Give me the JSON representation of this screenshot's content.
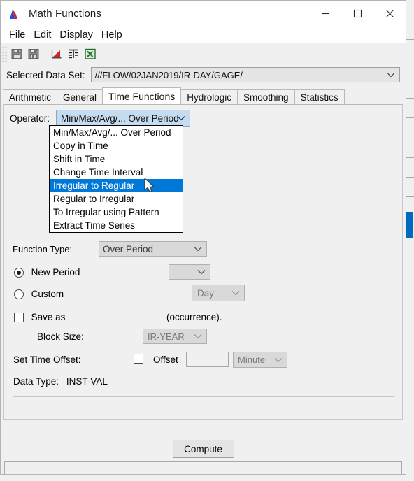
{
  "window": {
    "title": "Math Functions",
    "app_icon": "hec-dssvue-peak-icon",
    "controls": {
      "minimize": "—",
      "maximize": "☐",
      "close": "✕"
    }
  },
  "menu": {
    "items": [
      {
        "label": "File",
        "name": "menu-file"
      },
      {
        "label": "Edit",
        "name": "menu-edit"
      },
      {
        "label": "Display",
        "name": "menu-display"
      },
      {
        "label": "Help",
        "name": "menu-help"
      }
    ]
  },
  "toolbar": {
    "buttons": [
      {
        "icon": "save-icon",
        "name": "toolbar-save"
      },
      {
        "icon": "save-as-icon",
        "name": "toolbar-save-as"
      },
      {
        "icon": "plot-chart-icon",
        "name": "toolbar-plot"
      },
      {
        "icon": "table-icon",
        "name": "toolbar-table"
      },
      {
        "icon": "excel-export-icon",
        "name": "toolbar-excel"
      }
    ]
  },
  "dataset": {
    "label": "Selected Data Set:",
    "value": "///FLOW/02JAN2019/IR-DAY/GAGE/",
    "arrow_icon": "chevron-down-icon"
  },
  "tabs": [
    {
      "label": "Arithmetic",
      "active": false
    },
    {
      "label": "General",
      "active": false
    },
    {
      "label": "Time Functions",
      "active": true
    },
    {
      "label": "Hydrologic",
      "active": false
    },
    {
      "label": "Smoothing",
      "active": false
    },
    {
      "label": "Statistics",
      "active": false
    }
  ],
  "operator": {
    "label": "Operator:",
    "value": "Min/Max/Avg/... Over Period",
    "expanded": true,
    "options": [
      "Min/Max/Avg/... Over Period",
      "Copy in Time",
      "Shift in Time",
      "Change Time Interval",
      "Irregular to Regular",
      "Regular to Irregular",
      "To Irregular using Pattern",
      "Extract Time Series"
    ],
    "highlighted_option": "Irregular to Regular",
    "highlighted_index": 4
  },
  "form": {
    "function_type_label": "Function Type:",
    "function_type_value": "Over Period",
    "new_period_label": "New Period",
    "new_period_value": "",
    "custom_label": "Custom",
    "custom_unit_value": "Day",
    "save_label": "Save as",
    "save_note": "(occurrence).",
    "block_size_label": "Block Size:",
    "block_size_value": "IR-YEAR",
    "time_offset_label": "Set Time Offset:",
    "offset_label": "Offset",
    "offset_value": "",
    "offset_unit_value": "Minute",
    "data_type_label": "Data Type:",
    "data_type_value": "INST-VAL"
  },
  "footer": {
    "compute_label": "Compute",
    "status_text": ""
  },
  "colors": {
    "accent_blue": "#0078d7",
    "scrollbar_thumb": "#0069c0",
    "combo_focus": "#c5dcf0",
    "window_bg": "#f0f0f0"
  }
}
